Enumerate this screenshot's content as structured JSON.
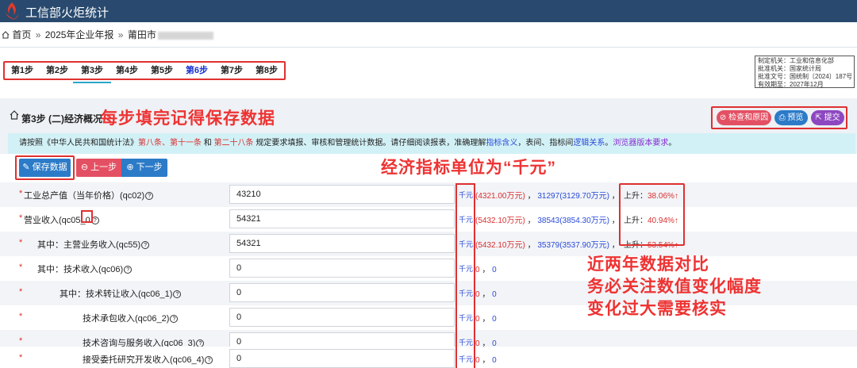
{
  "app": {
    "title": "工信部火炬统计"
  },
  "breadcrumb": {
    "home": "首页",
    "sep1": "»",
    "item1": "2025年企业年报",
    "sep2": "»",
    "item2": "莆田市"
  },
  "steps": [
    {
      "label": "第1步"
    },
    {
      "label": "第2步"
    },
    {
      "label": "第3步"
    },
    {
      "label": "第4步"
    },
    {
      "label": "第5步"
    },
    {
      "label": "第6步"
    },
    {
      "label": "第7步"
    },
    {
      "label": "第8步"
    }
  ],
  "current_step": 3,
  "info": {
    "line1": "制定机关：工业和信息化部",
    "line2": "批准机关：国家统计局",
    "line3": "批准文号：国统制〔2024〕187号",
    "line4": "有效期至：2027年12月"
  },
  "section": {
    "title": "第3步 (二)经济概况"
  },
  "annotations": {
    "save_tip": "每步填完记得保存数据",
    "unit_tip": "经济指标单位为“千元”",
    "compare_tip_1": "近两年数据对比",
    "compare_tip_2": "务必关注数值变化幅度",
    "compare_tip_3": "变化过大需要核实"
  },
  "actions": {
    "check": "检查和原因",
    "preview": "预览",
    "submit": "提交"
  },
  "notice": {
    "t1": "请按照《中华人民共和国统计法》",
    "r1": "第八条、第十一条",
    "t2": "和",
    "r2": "第二十八条",
    "t3": "规定要求填报、审核和管理统计数据。请仔细阅读报表，准确理解",
    "b1": "指标含义",
    "t4": "，表间、指标间",
    "b2": "逻辑关系",
    "t5": "。",
    "p1": "浏览器版本要求",
    "t6": "。"
  },
  "toolbar": {
    "save": "保存数据",
    "prev": "上一步",
    "next": "下一步"
  },
  "rows": [
    {
      "label": "工业总产值（当年价格）(qc02)",
      "value": "43210",
      "unit": "千元",
      "c1": "(4321.00万元)",
      "sep1": "，",
      "c2": "31297",
      "c3": "(3129.70万元)",
      "sep2": "，",
      "rise_label": "上升：",
      "rise_value": "38.06%↑"
    },
    {
      "label": "营业收入(qc05_0",
      "value": "54321",
      "unit": "千元",
      "c1": "(5432.10万元)",
      "sep1": "，",
      "c2": "38543",
      "c3": "(3854.30万元)",
      "sep2": "，",
      "rise_label": "上升：",
      "rise_value": "40.94%↑"
    },
    {
      "label": "其中：主营业务收入(qc55)",
      "value": "54321",
      "unit": "千元",
      "c1": "(5432.10万元)",
      "sep1": "，",
      "c2": "35379",
      "c3": "(3537.90万元)",
      "sep2": "，",
      "rise_label": "上升：",
      "rise_value": "53.54%↑"
    },
    {
      "label": "其中：技术收入(qc06)",
      "value": "0",
      "unit": "千元",
      "c1": "0",
      "sep1": "，",
      "c2": "0"
    },
    {
      "label": "其中：技术转让收入(qc06_1)",
      "value": "0",
      "unit": "千元",
      "c1": "0",
      "sep1": "，",
      "c2": "0"
    },
    {
      "label": "技术承包收入(qc06_2)",
      "value": "0",
      "unit": "千元",
      "c1": "0",
      "sep1": "，",
      "c2": "0"
    },
    {
      "label": "技术咨询与服务收入(qc06_3)",
      "value": "0",
      "unit": "千元",
      "c1": "0",
      "sep1": "，",
      "c2": "0"
    },
    {
      "label": "接受委托研究开发收入(qc06_4)",
      "value": "0",
      "unit": "千元",
      "c1": "0",
      "sep1": "，",
      "c2": "0"
    }
  ],
  "colors": {
    "header": "#294a6e",
    "danger": "#e45063",
    "primary": "#2c7bc8",
    "purple": "#8d47c0",
    "annotation": "#e33333",
    "notice_bg": "#d2f1f6"
  }
}
